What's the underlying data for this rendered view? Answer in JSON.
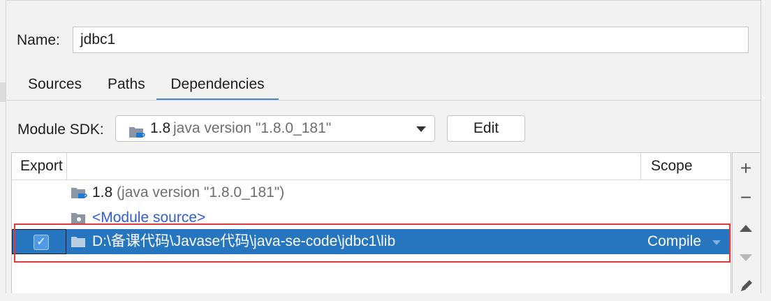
{
  "name_field": {
    "label": "Name:",
    "value": "jdbc1"
  },
  "tabs": [
    {
      "label": "Sources"
    },
    {
      "label": "Paths"
    },
    {
      "label": "Dependencies"
    }
  ],
  "module_sdk": {
    "label": "Module SDK:",
    "version": "1.8",
    "description": "java version \"1.8.0_181\"",
    "edit_label": "Edit"
  },
  "table": {
    "headers": {
      "export": "Export",
      "scope": "Scope"
    },
    "rows": [
      {
        "text": "1.8",
        "sub": "(java version \"1.8.0_181\")",
        "icon": "jdk-folder-icon"
      },
      {
        "text": "<Module source>",
        "icon": "module-folder-icon",
        "color": "#2f5fd0"
      },
      {
        "text": "D:\\备课代码\\Javase代码\\java-se-code\\jdbc1\\lib",
        "icon": "folder-icon",
        "scope": "Compile",
        "exported": true
      }
    ]
  },
  "toolbar": {
    "add": "+",
    "remove": "−"
  },
  "colors": {
    "selection": "#2675bf",
    "highlight_box": "#e0393e",
    "tab_underline": "#4a88c7",
    "link": "#2f5fd0"
  }
}
